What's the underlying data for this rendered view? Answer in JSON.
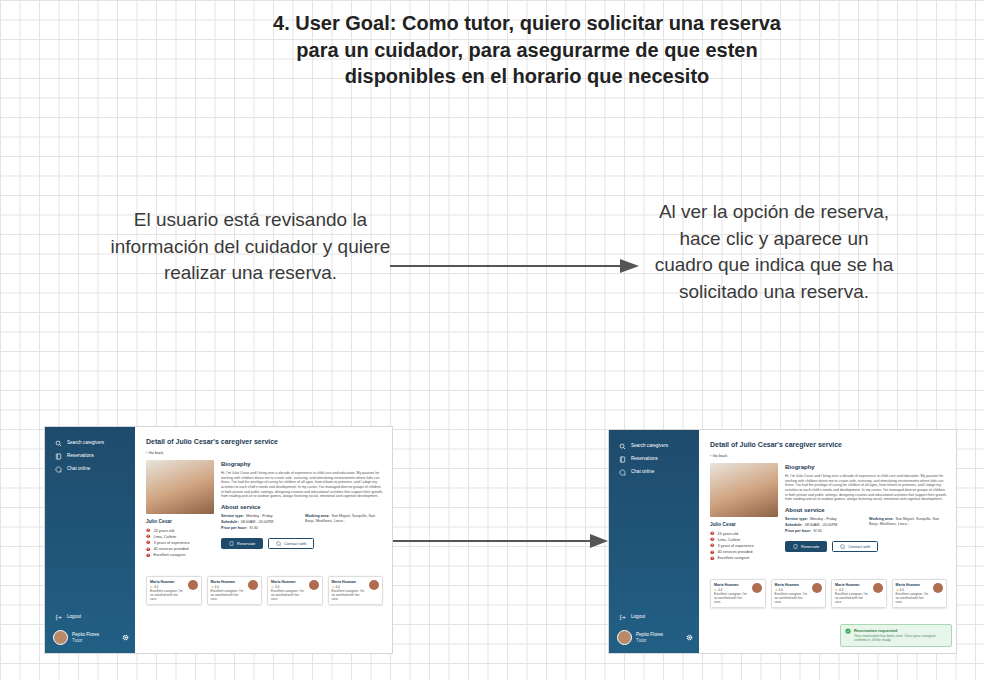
{
  "title": "4. User Goal: Como tutor, quiero solicitar una reserva para un cuidador, para asegurarme de que esten disponibles en el horario que necesito",
  "steps": [
    {
      "text": "El usuario está revisando la información del cuidador y quiere realizar una reserva."
    },
    {
      "text": "Al ver la opción de reserva, hace clic y aparece un cuadro que indica que se ha solicitado una reserva."
    }
  ],
  "screens": [
    {
      "sidebar": {
        "items": [
          {
            "label": "Search caregivers",
            "selected": false
          },
          {
            "label": "Reservations",
            "selected": false
          },
          {
            "label": "Chat online",
            "selected": false
          }
        ],
        "logout": "Logout",
        "user": {
          "name": "Pepito Flores",
          "role": "Tutor"
        }
      },
      "page_title": "Detail of Julio Cesar's caregiver service",
      "back": "Go back",
      "profile": {
        "name": "Julio Cesar",
        "facts": [
          "24 years old",
          "Lima, Cañete",
          "3 years of experience",
          "40 services provided",
          "Excellent caregiver"
        ]
      },
      "bio_heading": "Biography",
      "bio": "Hi, I'm Julio Cesar and I bring over a decade of experience in child care and education. My passion for working with children drives me to create safe, nurturing, and stimulating environments where kids can thrive. I've had the privilege of caring for children of all ages, from infants to preteens, and I adapt my activities to each child's needs and development. In my career, I've managed diverse groups of children in both private and public settings, designing creative and educational activities that support their growth, from reading and art to outdoor games, always fostering social, emotional and cognitive development.",
      "about_heading": "About service",
      "service": [
        {
          "label": "Service type:",
          "value": "Monday - Friday"
        },
        {
          "label": "Schedule:",
          "value": "08:00AM - 05:00PM"
        },
        {
          "label": "Price per hour:",
          "value": "S/.30"
        },
        {
          "label": "Working area:",
          "value": "San Miguel, Surquillo, San Borja, Miraflores, Lince..."
        }
      ],
      "buttons": [
        "Reservate",
        "Contact with"
      ],
      "caregivers": [
        {
          "name": "Maria Huaman",
          "rating": "4.4",
          "text": "Excellent caregiver. I'm so satisfied with her care."
        },
        {
          "name": "Maria Huaman",
          "rating": "4.4",
          "text": "Excellent caregiver. I'm so satisfied with her care."
        },
        {
          "name": "Maria Huaman",
          "rating": "4.4",
          "text": "Excellent caregiver. I'm so satisfied with her care."
        },
        {
          "name": "Maria Huaman",
          "rating": "4.4",
          "text": "Excellent caregiver. I'm so satisfied with her care."
        }
      ]
    },
    {
      "sidebar": {
        "items": [
          {
            "label": "Search caregivers",
            "selected": false
          },
          {
            "label": "Reservations",
            "selected": false
          },
          {
            "label": "Chat online",
            "selected": false
          }
        ],
        "logout": "Logout",
        "user": {
          "name": "Pepito Flores",
          "role": "Tutor"
        }
      },
      "page_title": "Detail of Julio Cesar's caregiver service",
      "back": "Go back",
      "profile": {
        "name": "Julio Cesar",
        "facts": [
          "24 years old",
          "Lima, Cañete",
          "3 years of experience",
          "40 services provided",
          "Excellent caregiver"
        ]
      },
      "bio_heading": "Biography",
      "bio": "Hi, I'm Julio Cesar and I bring over a decade of experience in child care and education. My passion for working with children drives me to create safe, nurturing, and stimulating environments where kids can thrive. I've had the privilege of caring for children of all ages, from infants to preteens, and I adapt my activities to each child's needs and development. In my career, I've managed diverse groups of children in both private and public settings, designing creative and educational activities that support their growth, from reading and art to outdoor games, always fostering social, emotional and cognitive development.",
      "about_heading": "About service",
      "service": [
        {
          "label": "Service type:",
          "value": "Monday - Friday"
        },
        {
          "label": "Schedule:",
          "value": "08:00AM - 05:00PM"
        },
        {
          "label": "Price per hour:",
          "value": "S/.30"
        },
        {
          "label": "Working area:",
          "value": "San Miguel, Surquillo, San Borja, Miraflores, Lince..."
        }
      ],
      "buttons": [
        "Reservate",
        "Contact with"
      ],
      "caregivers": [
        {
          "name": "Maria Huaman",
          "rating": "4.4",
          "text": "Excellent caregiver. I'm so satisfied with her care."
        },
        {
          "name": "Maria Huaman",
          "rating": "4.4",
          "text": "Excellent caregiver. I'm so satisfied with her care."
        },
        {
          "name": "Maria Huaman",
          "rating": "4.4",
          "text": "Excellent caregiver. I'm so satisfied with her care."
        },
        {
          "name": "Maria Huaman",
          "rating": "4.4",
          "text": "Excellent caregiver. I'm so satisfied with her care."
        }
      ],
      "toast": {
        "title": "Reservation requested",
        "text": "Your reservation has been sent. Once your caregiver confirms it, it'll be ready."
      }
    }
  ]
}
